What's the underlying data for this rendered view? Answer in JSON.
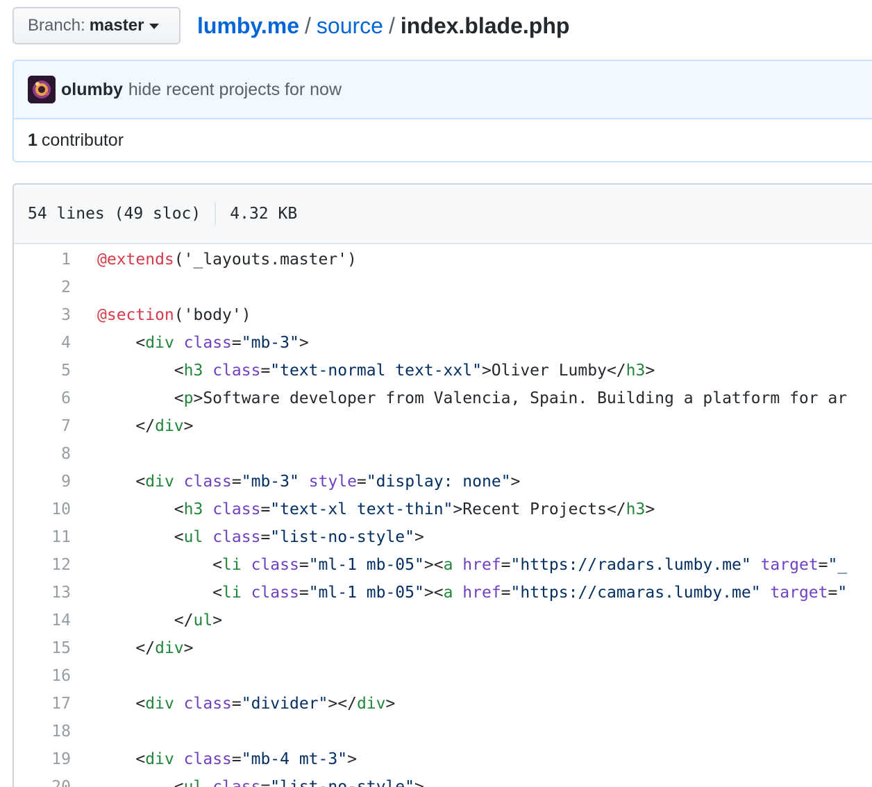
{
  "branch": {
    "prefix": "Branch:",
    "name": "master"
  },
  "breadcrumb": {
    "repo": "lumby.me",
    "separator": "/",
    "folder": "source",
    "file": "index.blade.php"
  },
  "commit": {
    "author": "olumby",
    "message": "hide recent projects for now"
  },
  "contributors": {
    "count": "1",
    "label": "contributor"
  },
  "file_info": {
    "lines": "54 lines (49 sloc)",
    "size": "4.32 KB"
  },
  "code_lines": [
    {
      "n": "1",
      "tokens": [
        [
          "at",
          "@extends"
        ],
        [
          "txt",
          "('_layouts.master')"
        ]
      ]
    },
    {
      "n": "2",
      "tokens": []
    },
    {
      "n": "3",
      "tokens": [
        [
          "at",
          "@section"
        ],
        [
          "txt",
          "('body')"
        ]
      ]
    },
    {
      "n": "4",
      "tokens": [
        [
          "txt",
          "    <"
        ],
        [
          "tag",
          "div"
        ],
        [
          "txt",
          " "
        ],
        [
          "attr",
          "class"
        ],
        [
          "txt",
          "="
        ],
        [
          "str",
          "\"mb-3\""
        ],
        [
          "txt",
          ">"
        ]
      ]
    },
    {
      "n": "5",
      "tokens": [
        [
          "txt",
          "        <"
        ],
        [
          "tag",
          "h3"
        ],
        [
          "txt",
          " "
        ],
        [
          "attr",
          "class"
        ],
        [
          "txt",
          "="
        ],
        [
          "str",
          "\"text-normal text-xxl\""
        ],
        [
          "txt",
          ">Oliver Lumby</"
        ],
        [
          "tag",
          "h3"
        ],
        [
          "txt",
          ">"
        ]
      ]
    },
    {
      "n": "6",
      "tokens": [
        [
          "txt",
          "        <"
        ],
        [
          "tag",
          "p"
        ],
        [
          "txt",
          ">Software developer from Valencia, Spain. Building a platform for ar"
        ]
      ]
    },
    {
      "n": "7",
      "tokens": [
        [
          "txt",
          "    </"
        ],
        [
          "tag",
          "div"
        ],
        [
          "txt",
          ">"
        ]
      ]
    },
    {
      "n": "8",
      "tokens": []
    },
    {
      "n": "9",
      "tokens": [
        [
          "txt",
          "    <"
        ],
        [
          "tag",
          "div"
        ],
        [
          "txt",
          " "
        ],
        [
          "attr",
          "class"
        ],
        [
          "txt",
          "="
        ],
        [
          "str",
          "\"mb-3\""
        ],
        [
          "txt",
          " "
        ],
        [
          "attr",
          "style"
        ],
        [
          "txt",
          "="
        ],
        [
          "str",
          "\"display: none\""
        ],
        [
          "txt",
          ">"
        ]
      ]
    },
    {
      "n": "10",
      "tokens": [
        [
          "txt",
          "        <"
        ],
        [
          "tag",
          "h3"
        ],
        [
          "txt",
          " "
        ],
        [
          "attr",
          "class"
        ],
        [
          "txt",
          "="
        ],
        [
          "str",
          "\"text-xl text-thin\""
        ],
        [
          "txt",
          ">Recent Projects</"
        ],
        [
          "tag",
          "h3"
        ],
        [
          "txt",
          ">"
        ]
      ]
    },
    {
      "n": "11",
      "tokens": [
        [
          "txt",
          "        <"
        ],
        [
          "tag",
          "ul"
        ],
        [
          "txt",
          " "
        ],
        [
          "attr",
          "class"
        ],
        [
          "txt",
          "="
        ],
        [
          "str",
          "\"list-no-style\""
        ],
        [
          "txt",
          ">"
        ]
      ]
    },
    {
      "n": "12",
      "tokens": [
        [
          "txt",
          "            <"
        ],
        [
          "tag",
          "li"
        ],
        [
          "txt",
          " "
        ],
        [
          "attr",
          "class"
        ],
        [
          "txt",
          "="
        ],
        [
          "str",
          "\"ml-1 mb-05\""
        ],
        [
          "txt",
          "><"
        ],
        [
          "tag",
          "a"
        ],
        [
          "txt",
          " "
        ],
        [
          "attr",
          "href"
        ],
        [
          "txt",
          "="
        ],
        [
          "str",
          "\"https://radars.lumby.me\""
        ],
        [
          "txt",
          " "
        ],
        [
          "attr",
          "target"
        ],
        [
          "txt",
          "="
        ],
        [
          "str",
          "\"_"
        ]
      ]
    },
    {
      "n": "13",
      "tokens": [
        [
          "txt",
          "            <"
        ],
        [
          "tag",
          "li"
        ],
        [
          "txt",
          " "
        ],
        [
          "attr",
          "class"
        ],
        [
          "txt",
          "="
        ],
        [
          "str",
          "\"ml-1 mb-05\""
        ],
        [
          "txt",
          "><"
        ],
        [
          "tag",
          "a"
        ],
        [
          "txt",
          " "
        ],
        [
          "attr",
          "href"
        ],
        [
          "txt",
          "="
        ],
        [
          "str",
          "\"https://camaras.lumby.me\""
        ],
        [
          "txt",
          " "
        ],
        [
          "attr",
          "target"
        ],
        [
          "txt",
          "="
        ],
        [
          "str",
          "\""
        ]
      ]
    },
    {
      "n": "14",
      "tokens": [
        [
          "txt",
          "        </"
        ],
        [
          "tag",
          "ul"
        ],
        [
          "txt",
          ">"
        ]
      ]
    },
    {
      "n": "15",
      "tokens": [
        [
          "txt",
          "    </"
        ],
        [
          "tag",
          "div"
        ],
        [
          "txt",
          ">"
        ]
      ]
    },
    {
      "n": "16",
      "tokens": []
    },
    {
      "n": "17",
      "tokens": [
        [
          "txt",
          "    <"
        ],
        [
          "tag",
          "div"
        ],
        [
          "txt",
          " "
        ],
        [
          "attr",
          "class"
        ],
        [
          "txt",
          "="
        ],
        [
          "str",
          "\"divider\""
        ],
        [
          "txt",
          "></"
        ],
        [
          "tag",
          "div"
        ],
        [
          "txt",
          ">"
        ]
      ]
    },
    {
      "n": "18",
      "tokens": []
    },
    {
      "n": "19",
      "tokens": [
        [
          "txt",
          "    <"
        ],
        [
          "tag",
          "div"
        ],
        [
          "txt",
          " "
        ],
        [
          "attr",
          "class"
        ],
        [
          "txt",
          "="
        ],
        [
          "str",
          "\"mb-4 mt-3\""
        ],
        [
          "txt",
          ">"
        ]
      ]
    },
    {
      "n": "20",
      "tokens": [
        [
          "txt",
          "        <"
        ],
        [
          "tag",
          "ul"
        ],
        [
          "txt",
          " "
        ],
        [
          "attr",
          "class"
        ],
        [
          "txt",
          "="
        ],
        [
          "str",
          "\"list-no-style\""
        ],
        [
          "txt",
          ">"
        ]
      ]
    }
  ]
}
